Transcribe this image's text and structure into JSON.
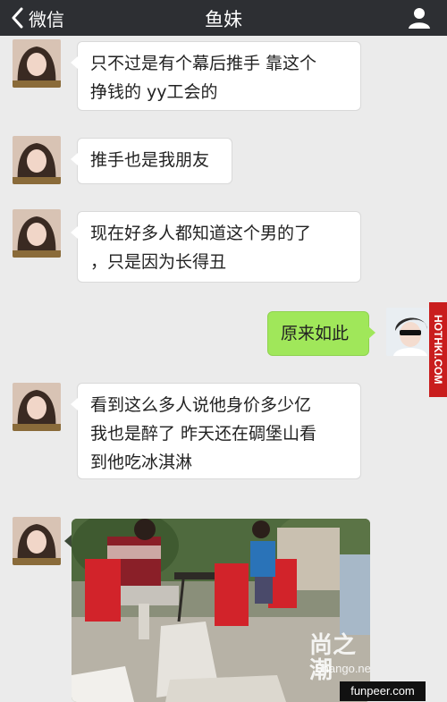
{
  "header": {
    "back_label": "微信",
    "title": "鱼妹"
  },
  "messages": [
    {
      "sender": "other",
      "lines": [
        "只不过是有个幕后推手 靠这个",
        "挣钱的 yy工会的"
      ]
    },
    {
      "sender": "other",
      "lines": [
        "推手也是我朋友"
      ]
    },
    {
      "sender": "other",
      "lines": [
        "现在好多人都知道这个男的了",
        "，只是因为长得丑"
      ]
    },
    {
      "sender": "me",
      "lines": [
        "原来如此"
      ]
    },
    {
      "sender": "other",
      "lines": [
        "看到这么多人说他身价多少亿",
        "我也是醉了 昨天还在碉堡山看",
        "到他吃冰淇淋"
      ]
    },
    {
      "sender": "other",
      "type": "photo"
    }
  ],
  "watermarks": {
    "side": "HOTHKI.COM",
    "shango_main": "尚之潮",
    "shango_sub": "Shango.net",
    "funpeer": "funpeer.com"
  },
  "colors": {
    "nav_bg": "#2d2f33",
    "chat_bg": "#ebebeb",
    "mine_bubble": "#a0e75a",
    "other_bubble": "#ffffff"
  }
}
